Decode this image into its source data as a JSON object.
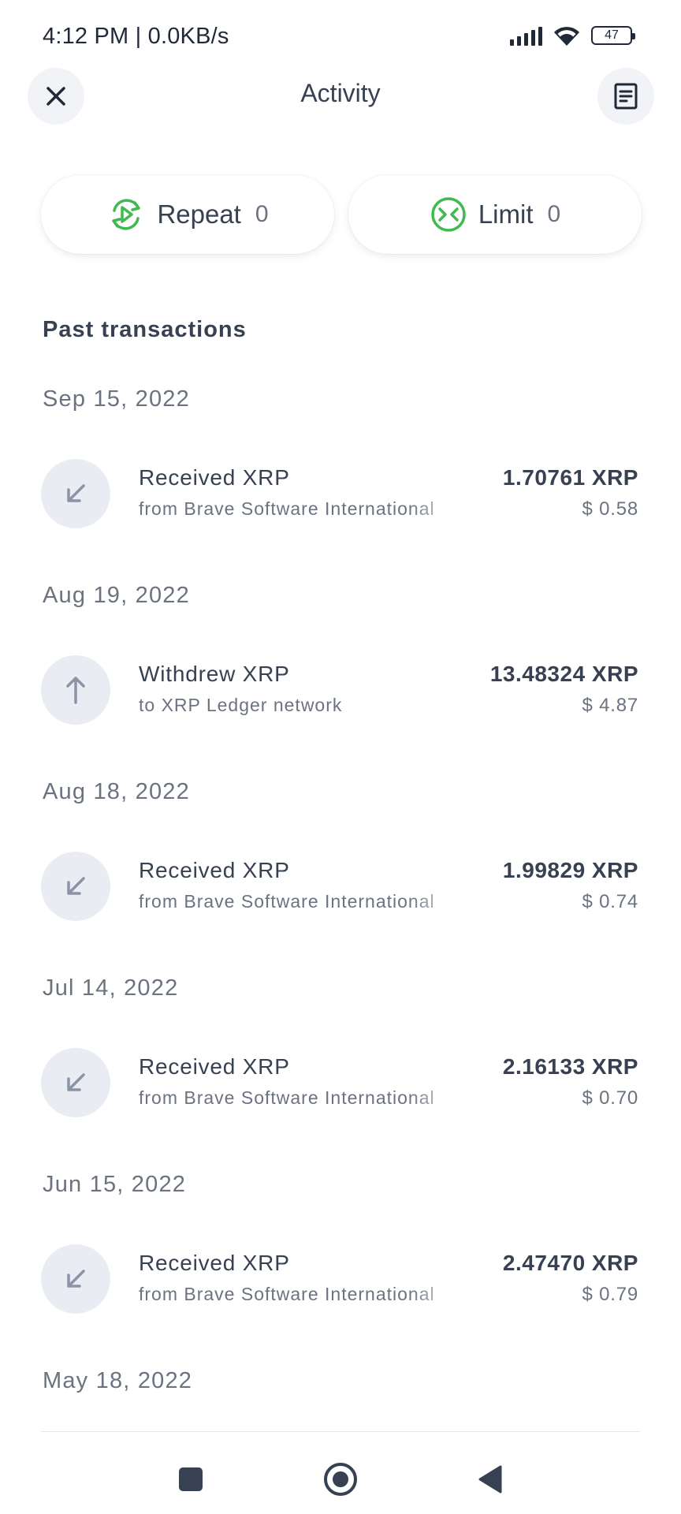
{
  "status_bar": {
    "time": "4:12 PM | 0.0KB/s",
    "battery": "47",
    "icons": [
      "signal-icon",
      "wifi-icon",
      "battery-icon"
    ]
  },
  "header": {
    "title": "Activity",
    "close_icon": "close-icon",
    "statement_icon": "document-icon"
  },
  "pills": [
    {
      "label": "Repeat",
      "count": "0",
      "icon": "repeat-icon",
      "color": "#3fb950"
    },
    {
      "label": "Limit",
      "count": "0",
      "icon": "limit-icon",
      "color": "#3fb950"
    }
  ],
  "past_transactions": {
    "title": "Past transactions",
    "groups": [
      {
        "date": "Sep 15, 2022",
        "tx": {
          "type": "received",
          "icon": "arrow-down-left-icon",
          "title": "Received XRP",
          "subtitle": "from Brave Software International",
          "amount": "1.70761 XRP",
          "fiat": "$ 0.58"
        }
      },
      {
        "date": "Aug 19, 2022",
        "tx": {
          "type": "withdrew",
          "icon": "arrow-up-icon",
          "title": "Withdrew XRP",
          "subtitle": "to XRP Ledger network",
          "amount": "13.48324 XRP",
          "fiat": "$ 4.87"
        }
      },
      {
        "date": "Aug 18, 2022",
        "tx": {
          "type": "received",
          "icon": "arrow-down-left-icon",
          "title": "Received XRP",
          "subtitle": "from Brave Software International",
          "amount": "1.99829 XRP",
          "fiat": "$ 0.74"
        }
      },
      {
        "date": "Jul 14, 2022",
        "tx": {
          "type": "received",
          "icon": "arrow-down-left-icon",
          "title": "Received XRP",
          "subtitle": "from Brave Software International",
          "amount": "2.16133 XRP",
          "fiat": "$ 0.70"
        }
      },
      {
        "date": "Jun 15, 2022",
        "tx": {
          "type": "received",
          "icon": "arrow-down-left-icon",
          "title": "Received XRP",
          "subtitle": "from Brave Software International",
          "amount": "2.47470 XRP",
          "fiat": "$ 0.79"
        }
      },
      {
        "date": "May 18, 2022"
      }
    ]
  },
  "nav_bar": {
    "icons": [
      "recent-apps-icon",
      "home-icon",
      "back-icon"
    ]
  }
}
